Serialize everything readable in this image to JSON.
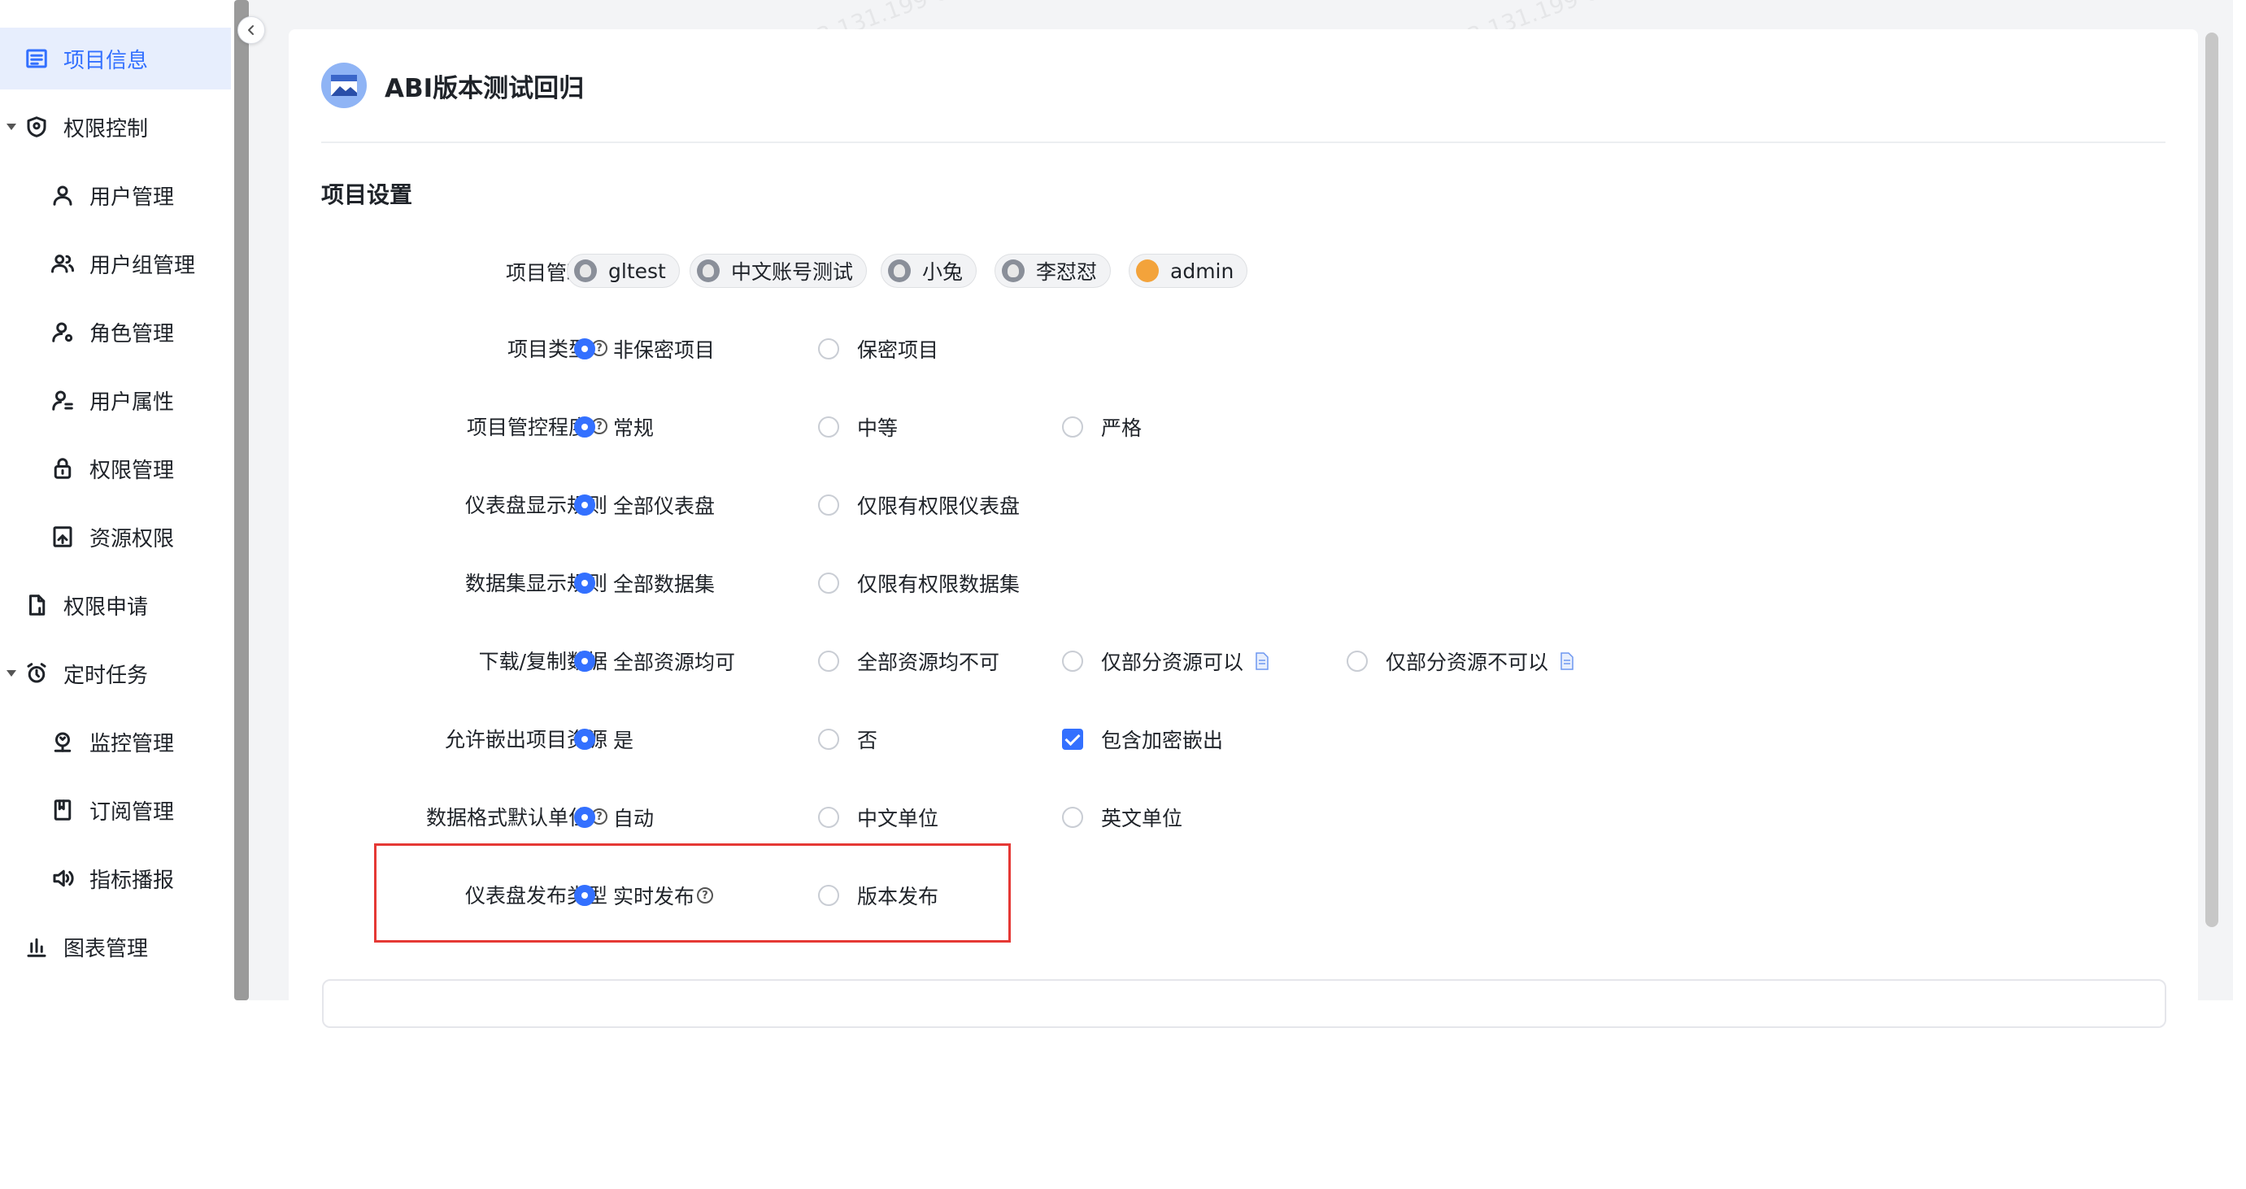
{
  "sidebar": {
    "items": [
      {
        "label": "项目信息",
        "icon": "list-icon"
      },
      {
        "label": "权限控制",
        "icon": "shield-icon"
      },
      {
        "label": "用户管理",
        "icon": "user-icon"
      },
      {
        "label": "用户组管理",
        "icon": "user-group-icon"
      },
      {
        "label": "角色管理",
        "icon": "role-icon"
      },
      {
        "label": "用户属性",
        "icon": "user-attribute-icon"
      },
      {
        "label": "权限管理",
        "icon": "lock-icon"
      },
      {
        "label": "资源权限",
        "icon": "resource-permission-icon"
      },
      {
        "label": "权限申请",
        "icon": "permission-request-icon"
      },
      {
        "label": "定时任务",
        "icon": "alarm-clock-icon"
      },
      {
        "label": "监控管理",
        "icon": "monitor-icon"
      },
      {
        "label": "订阅管理",
        "icon": "bookmark-icon"
      },
      {
        "label": "指标播报",
        "icon": "speaker-icon"
      },
      {
        "label": "图表管理",
        "icon": "bar-chart-icon"
      }
    ]
  },
  "project": {
    "title": "ABI版本测试回归"
  },
  "section": {
    "title": "项目设置"
  },
  "managers": {
    "label": "项目管理员",
    "chips": [
      "gltest",
      "中文账号测试",
      "小兔",
      "李怼怼",
      "admin"
    ]
  },
  "settings": [
    {
      "label": "项目类型",
      "options": [
        "非保密项目",
        "保密项目"
      ]
    },
    {
      "label": "项目管控程度",
      "options": [
        "常规",
        "中等",
        "严格"
      ]
    },
    {
      "label": "仪表盘显示规则",
      "options": [
        "全部仪表盘",
        "仅限有权限仪表盘"
      ]
    },
    {
      "label": "数据集显示规则",
      "options": [
        "全部数据集",
        "仅限有权限数据集"
      ]
    },
    {
      "label": "下载/复制数据",
      "options": [
        "全部资源均可",
        "全部资源均不可",
        "仅部分资源可以",
        "仅部分资源不可以"
      ]
    },
    {
      "label": "允许嵌出项目资源",
      "options": [
        "是",
        "否"
      ],
      "checkbox": "包含加密嵌出"
    },
    {
      "label": "数据格式默认单位",
      "options": [
        "自动",
        "中文单位",
        "英文单位"
      ]
    },
    {
      "label": "仪表盘发布类型",
      "options": [
        "实时发布",
        "版本发布"
      ]
    }
  ],
  "colors": {
    "accent": "#3370ff",
    "highlight": "#e53935",
    "active_bg": "#e7eefd"
  }
}
